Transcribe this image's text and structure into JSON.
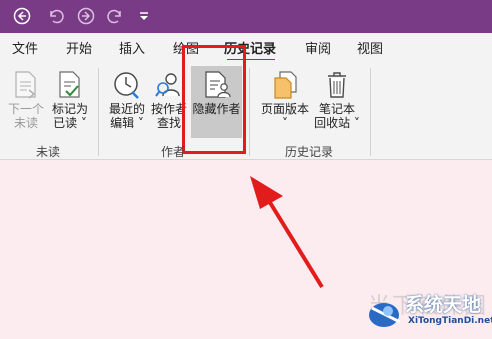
{
  "quick_access": [
    "back-icon",
    "undo-icon",
    "forward-icon",
    "redo-icon",
    "customize-icon"
  ],
  "tabs": [
    {
      "label": "文件"
    },
    {
      "label": "开始"
    },
    {
      "label": "插入"
    },
    {
      "label": "绘图"
    },
    {
      "label": "历史记录",
      "active": true
    },
    {
      "label": "审阅"
    },
    {
      "label": "视图"
    }
  ],
  "groups": {
    "unread": {
      "label": "未读",
      "next_unread": {
        "line1": "下一个",
        "line2": "未读",
        "enabled": false
      },
      "mark_read": {
        "line1": "标记为",
        "line2": "已读 ˅"
      }
    },
    "authors": {
      "label": "作者",
      "recent_edits": {
        "line1": "最近的",
        "line2": "编辑 ˅"
      },
      "find_by_author": {
        "line1": "按作者",
        "line2": "查找"
      },
      "hide_authors": {
        "line1": "隐藏作者",
        "highlighted": true
      }
    },
    "history": {
      "label": "历史记录",
      "page_versions": {
        "line1": "页面版本",
        "line2": "˅"
      },
      "notebook_recycle": {
        "line1": "笔记本",
        "line2": "回收站 ˅"
      }
    }
  },
  "annotation": {
    "color": "#e21b1b"
  },
  "watermark": {
    "faint": "当下软件园",
    "brand": "系统天地",
    "url": "XiTongTianDi.net"
  },
  "colors": {
    "accent": "#7a3b86",
    "ribbon_bg": "#f3f3f3",
    "content_bg": "#fcebef"
  }
}
